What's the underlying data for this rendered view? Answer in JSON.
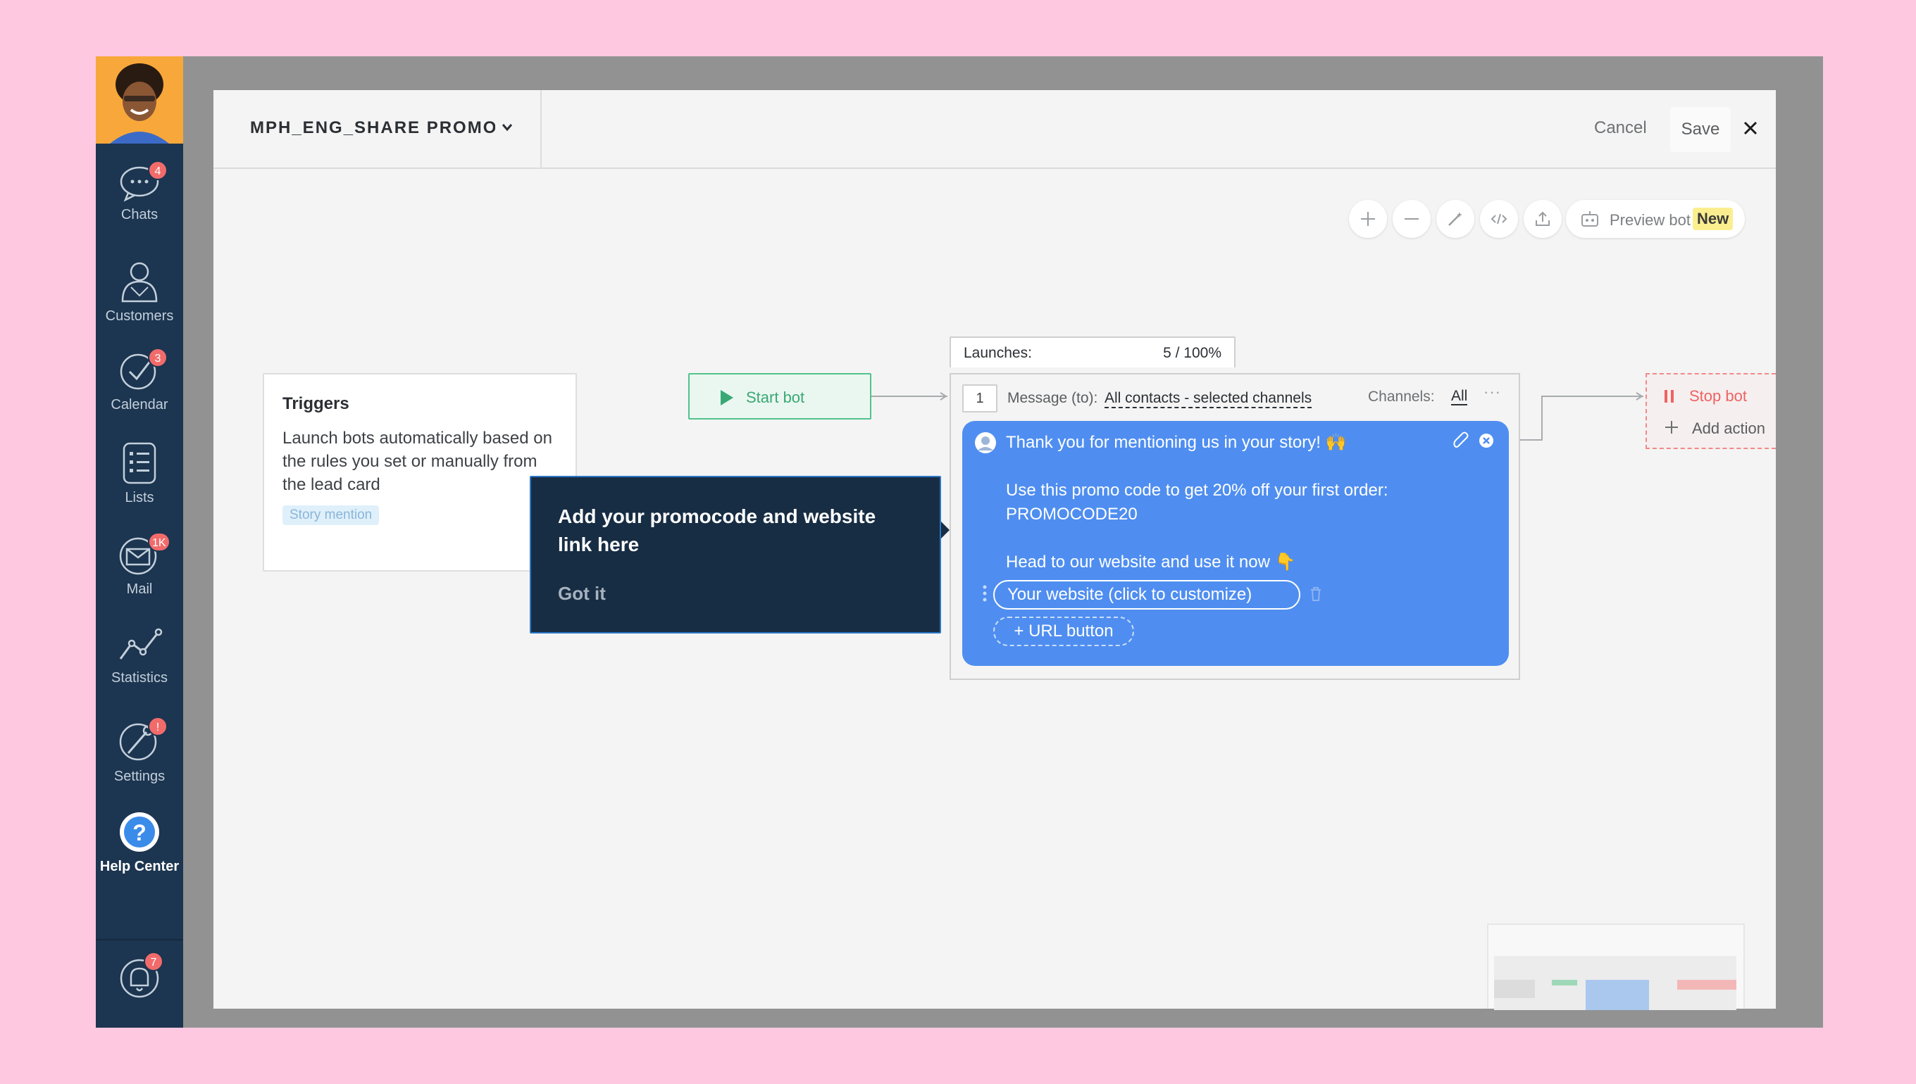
{
  "sidebar": {
    "items": [
      {
        "label": "Chats",
        "badge": "4",
        "icon": "chat-icon"
      },
      {
        "label": "Customers",
        "badge": "",
        "icon": "customers-icon"
      },
      {
        "label": "Calendar",
        "badge": "3",
        "icon": "calendar-check-icon"
      },
      {
        "label": "Lists",
        "badge": "",
        "icon": "lists-icon"
      },
      {
        "label": "Mail",
        "badge": "1K",
        "icon": "mail-icon"
      },
      {
        "label": "Statistics",
        "badge": "",
        "icon": "statistics-icon"
      },
      {
        "label": "Settings",
        "badge": "!",
        "icon": "settings-icon"
      },
      {
        "label": "Help Center",
        "badge": "",
        "icon": "help-icon"
      }
    ],
    "notifications_badge": "7"
  },
  "header": {
    "bot_title": "MPH_ENG_SHARE PROMO CODE",
    "cancel_label": "Cancel",
    "save_label": "Save"
  },
  "toolbar": {
    "preview_label": "Preview bot",
    "new_badge": "New"
  },
  "triggers": {
    "title": "Triggers",
    "description": "Launch bots automatically based on the rules you set or manually from the lead card",
    "tag": "Story mention"
  },
  "tooltip": {
    "text": "Add your promocode and website link here",
    "action": "Got it"
  },
  "start_bot": {
    "label": "Start bot"
  },
  "message": {
    "launches_label": "Launches:",
    "launches_value": "5 / 100%",
    "step_number": "1",
    "to_label": "Message (to):",
    "recipients": "All contacts - selected channels",
    "channels_label": "Channels:",
    "channels_value": "All",
    "more": "···",
    "text": "Thank you for mentioning us in your story! 🙌\n\nUse this promo code to get 20% off your first order:\nPROMOCODE20\n\nHead to our website and use it now 👇",
    "url_pill": "Your website (click to customize)",
    "url_button": "+ URL button"
  },
  "stop_bot": {
    "label": "Stop bot",
    "add_action": "Add action"
  },
  "colors": {
    "sidebar": "#1c3550",
    "bubble": "#4f8ef0",
    "start_green": "#52c38d",
    "stop_red": "#ef6262",
    "badge_red": "#f26b6b",
    "background_pink": "#fdc8e0"
  }
}
